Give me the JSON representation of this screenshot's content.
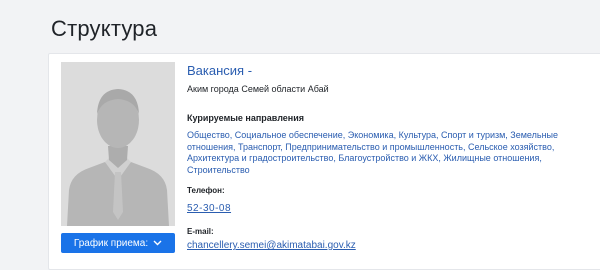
{
  "page": {
    "title": "Структура"
  },
  "card": {
    "photo_icon": "person-silhouette-icon",
    "schedule_button": {
      "label": "График приема:",
      "icon": "chevron-down-icon"
    },
    "vacancy_title": "Вакансия -",
    "position": "Аким города Семей области Абай",
    "directions_heading": "Курируемые направления",
    "directions": "Общество, Социальное обеспечение, Экономика, Культура, Спорт и туризм, Земельные отношения, Транспорт, Предпринимательство и промышленность, Сельское хозяйство, Архитектура и градостроительство, Благоустройство и ЖКХ, Жилищные отношения, Строительство",
    "phone_label": "Телефон:",
    "phone": "52-30-08",
    "email_label": "E-mail:",
    "email": "chancellery.semei@akimatabai.gov.kz"
  },
  "colors": {
    "accent": "#1a73e8",
    "link": "#2a5db0",
    "background": "#f2f3f5"
  }
}
